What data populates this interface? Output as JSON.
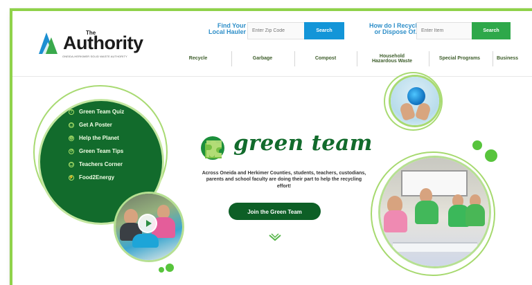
{
  "header": {
    "logo_small": "The",
    "logo_text": "Authority",
    "logo_tagline": "Oneida-Herkimer Solid Waste Authority",
    "find_label_line1": "Find Your",
    "find_label_line2": "Local Hauler",
    "zip_placeholder": "Enter Zip Code",
    "zip_search_label": "Search",
    "how_label_line1": "How do I Recycle",
    "how_label_line2": "or Dispose Of...",
    "item_placeholder": "Enter Item",
    "item_search_label": "Search",
    "nav": [
      {
        "line1": "Recycle",
        "line2": ""
      },
      {
        "line1": "Garbage",
        "line2": ""
      },
      {
        "line1": "Compost",
        "line2": ""
      },
      {
        "line1": "Household",
        "line2": "Hazardous Waste"
      },
      {
        "line1": "Special Programs",
        "line2": ""
      },
      {
        "line1": "Business",
        "line2": ""
      }
    ]
  },
  "hero": {
    "menu": [
      {
        "label": "Green Team Quiz",
        "icon": "?"
      },
      {
        "label": "Get A Poster",
        "icon": "▢"
      },
      {
        "label": "Help the Planet",
        "icon": "◍"
      },
      {
        "label": "Green Team Tips",
        "icon": "↺"
      },
      {
        "label": "Teachers Corner",
        "icon": "▢"
      },
      {
        "label": "Food2Energy",
        "icon": "⚡"
      }
    ],
    "title": "green team",
    "description": "Across Oneida and Herkimer Counties, students, teachers, custodians, parents and school faculty are doing their part to help the recycling effort!",
    "join_button": "Join the Green Team"
  },
  "colors": {
    "accent_green": "#2ea84a",
    "dark_green": "#126b2c",
    "search_blue": "#1395d8",
    "label_blue": "#2d8ec8",
    "frame_green": "#8fd24a"
  }
}
